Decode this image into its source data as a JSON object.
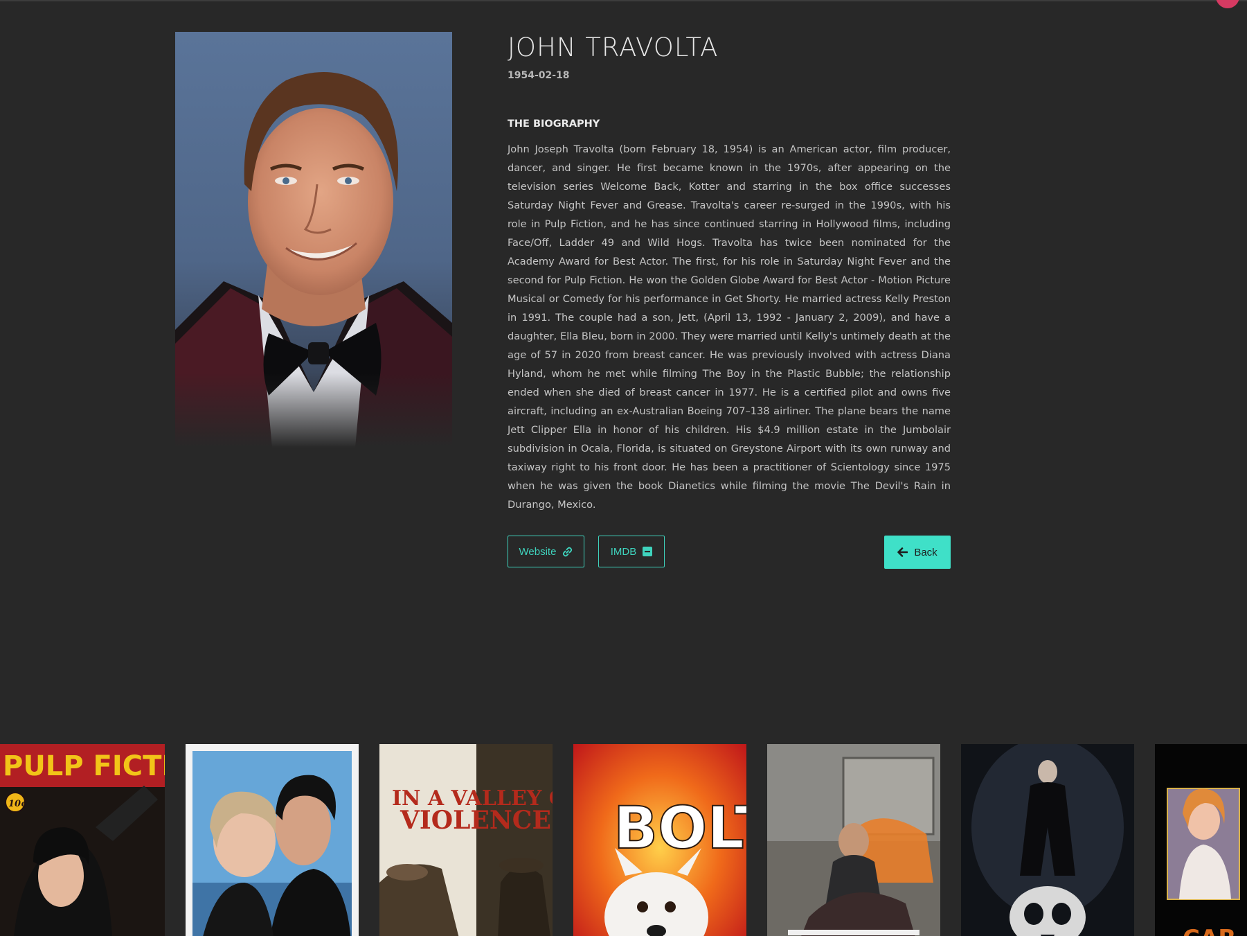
{
  "person": {
    "name": "JOHN TRAVOLTA",
    "birthday": "1954-02-18",
    "bio_heading": "THE BIOGRAPHY",
    "bio": "John Joseph Travolta (born February 18, 1954) is an American actor, film producer, dancer, and singer. He first became known in the 1970s, after appearing on the television series Welcome Back, Kotter and starring in the box office successes Saturday Night Fever and Grease. Travolta's career re-surged in the 1990s, with his role in Pulp Fiction, and he has since continued starring in Hollywood films, including Face/Off, Ladder 49 and Wild Hogs. Travolta has twice been nominated for the Academy Award for Best Actor. The first, for his role in Saturday Night Fever and the second for Pulp Fiction. He won the Golden Globe Award for Best Actor - Motion Picture Musical or Comedy for his performance in Get Shorty. He married actress Kelly Preston in 1991. The couple had a son, Jett, (April 13, 1992 - January 2, 2009), and have a daughter, Ella Bleu, born in 2000. They were married until Kelly's untimely death at the age of 57 in 2020 from breast cancer. He was previously involved with actress Diana Hyland, whom he met while filming The Boy in the Plastic Bubble; the relationship ended when she died of breast cancer in 1977. He is a certified pilot and owns five aircraft, including an ex-Australian Boeing 707–138 airliner. The plane bears the name Jett Clipper Ella in honor of his children. His $4.9 million estate in the Jumbolair subdivision in Ocala, Florida, is situated on Greystone Airport with its own runway and taxiway right to his front door. He has been a practitioner of Scientology since 1975 when he was given the book Dianetics while filming the movie The Devil's Rain in Durango, Mexico."
  },
  "actions": {
    "website_label": "Website",
    "website_icon": "link-icon",
    "imdb_label": "IMDB",
    "imdb_icon": "imdb-icon",
    "back_label": "Back",
    "back_icon": "arrow-left-icon"
  },
  "colors": {
    "background": "#282828",
    "accent": "#3fe0c8",
    "text": "#c4c4c4"
  },
  "filmography": [
    {
      "id": "pulp-fiction",
      "poster_text": [
        "PULP FICTION",
        "10¢"
      ]
    },
    {
      "id": "grease",
      "poster_text": []
    },
    {
      "id": "in-a-valley-of-violence",
      "poster_text": [
        "IN A VALLEY OF",
        "VIOLENCE"
      ]
    },
    {
      "id": "bolt",
      "poster_text": [
        "BOLT"
      ]
    },
    {
      "id": "die-hart",
      "poster_text": []
    },
    {
      "id": "the-punisher",
      "poster_text": []
    },
    {
      "id": "carrie",
      "poster_text": []
    }
  ]
}
